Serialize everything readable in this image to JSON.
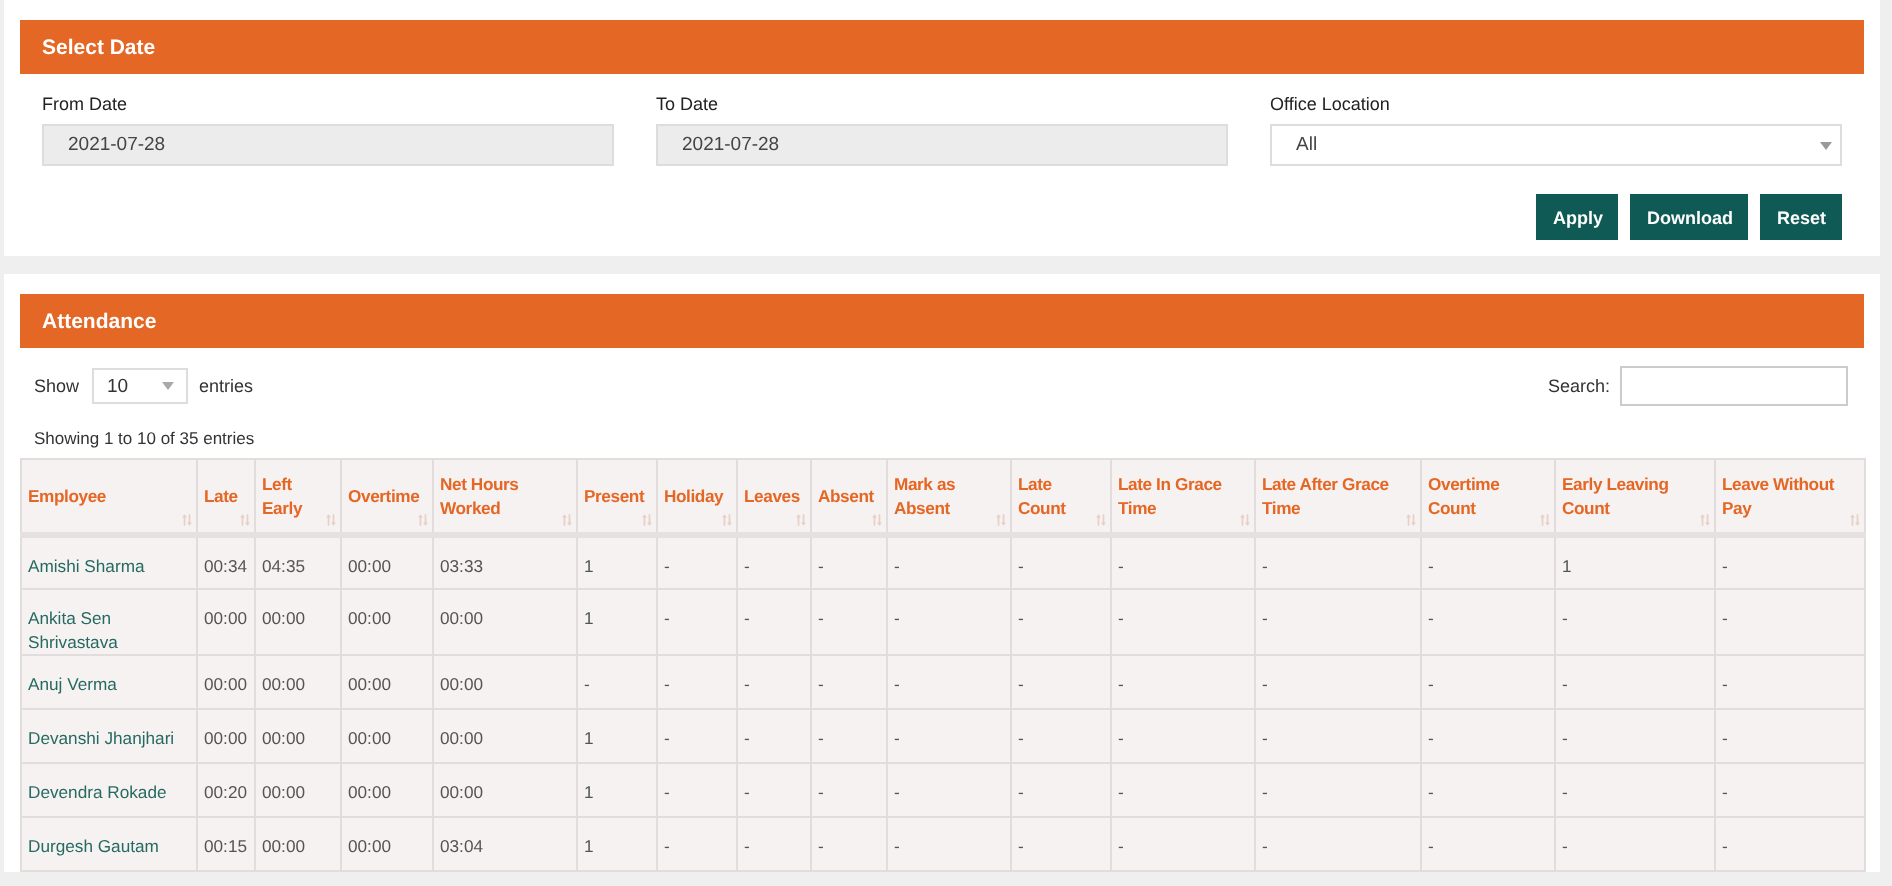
{
  "select_date": {
    "title": "Select Date",
    "fields": [
      {
        "label": "From Date",
        "value": "2021-07-28",
        "kind": "date"
      },
      {
        "label": "To Date",
        "value": "2021-07-28",
        "kind": "date"
      },
      {
        "label": "Office Location",
        "value": "All",
        "kind": "select"
      }
    ],
    "buttons": [
      "Apply",
      "Download",
      "Reset"
    ]
  },
  "attendance": {
    "title": "Attendance",
    "show_label": "Show",
    "page_size": "10",
    "entries_label": "entries",
    "search_label": "Search:",
    "info": "Showing 1 to 10 of 35 entries",
    "columns": [
      "Employee",
      "Late",
      "Left Early",
      "Overtime",
      "Net Hours Worked",
      "Present",
      "Holiday",
      "Leaves",
      "Absent",
      "Mark as Absent",
      "Late Count",
      "Late In Grace Time",
      "Late After Grace Time",
      "Overtime Count",
      "Early Leaving Count",
      "Leave Without Pay"
    ],
    "rows": [
      {
        "cells": [
          "Amishi Sharma",
          "00:34",
          "04:35",
          "00:00",
          "03:33",
          "1",
          "-",
          "-",
          "-",
          "-",
          "-",
          "-",
          "-",
          "-",
          "1",
          "-"
        ]
      },
      {
        "cells": [
          "Ankita Sen Shrivastava",
          "00:00",
          "00:00",
          "00:00",
          "00:00",
          "1",
          "-",
          "-",
          "-",
          "-",
          "-",
          "-",
          "-",
          "-",
          "-",
          "-"
        ]
      },
      {
        "cells": [
          "Anuj Verma",
          "00:00",
          "00:00",
          "00:00",
          "00:00",
          "-",
          "-",
          "-",
          "-",
          "-",
          "-",
          "-",
          "-",
          "-",
          "-",
          "-"
        ]
      },
      {
        "cells": [
          "Devanshi Jhanjhari",
          "00:00",
          "00:00",
          "00:00",
          "00:00",
          "1",
          "-",
          "-",
          "-",
          "-",
          "-",
          "-",
          "-",
          "-",
          "-",
          "-"
        ]
      },
      {
        "cells": [
          "Devendra Rokade",
          "00:20",
          "00:00",
          "00:00",
          "00:00",
          "1",
          "-",
          "-",
          "-",
          "-",
          "-",
          "-",
          "-",
          "-",
          "-",
          "-"
        ]
      },
      {
        "cells": [
          "Durgesh Gautam",
          "00:15",
          "00:00",
          "00:00",
          "03:04",
          "1",
          "-",
          "-",
          "-",
          "-",
          "-",
          "-",
          "-",
          "-",
          "-",
          "-"
        ]
      }
    ]
  }
}
